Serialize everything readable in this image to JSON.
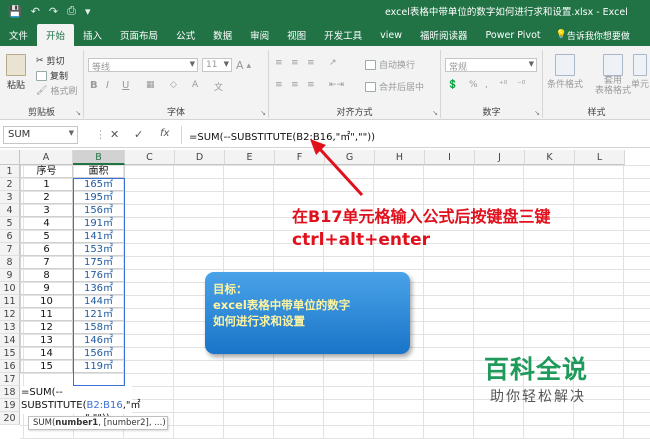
{
  "window": {
    "title": "excel表格中带单位的数字如何进行求和设置.xlsx - Excel"
  },
  "tabs": [
    "文件",
    "开始",
    "插入",
    "页面布局",
    "公式",
    "数据",
    "审阅",
    "视图",
    "开发工具",
    "view",
    "福昕阅读器",
    "Power Pivot"
  ],
  "active_tab": "开始",
  "tell_me": "告诉我你想要做",
  "ribbon": {
    "paste": "粘贴",
    "cut": "剪切",
    "copy": "复制",
    "format_painter": "格式刷",
    "clipboard": "剪贴板",
    "font_name": "等线",
    "font_size": "11",
    "bold": "B",
    "italic": "I",
    "underline": "U",
    "font_group": "字体",
    "wrap_text": "自动换行",
    "merge_center": "合并后居中",
    "alignment_group": "对齐方式",
    "number_format": "常规",
    "percent": "%",
    "comma": ",",
    "number_group": "数字",
    "cond_format": "条件格式",
    "table_format_1": "套用",
    "table_format_2": "表格格式",
    "cell_styles": "单元",
    "styles_group": "样式"
  },
  "formula_bar": {
    "name_box": "SUM",
    "cancel": "✕",
    "enter": "✓",
    "fx": "fx",
    "formula": "=SUM(--SUBSTITUTE(B2:B16,\"㎡\",\"\"))"
  },
  "columns": [
    "A",
    "B",
    "C",
    "D",
    "E",
    "F",
    "G",
    "H",
    "I",
    "J",
    "K",
    "L"
  ],
  "rows": [
    "1",
    "2",
    "3",
    "4",
    "5",
    "6",
    "7",
    "8",
    "9",
    "10",
    "11",
    "12",
    "13",
    "14",
    "15",
    "16",
    "17",
    "18",
    "19",
    "20"
  ],
  "table": {
    "header": [
      "序号",
      "面积"
    ],
    "data": [
      [
        "1",
        "165㎡"
      ],
      [
        "2",
        "195㎡"
      ],
      [
        "3",
        "156㎡"
      ],
      [
        "4",
        "191㎡"
      ],
      [
        "5",
        "141㎡"
      ],
      [
        "6",
        "153㎡"
      ],
      [
        "7",
        "175㎡"
      ],
      [
        "8",
        "176㎡"
      ],
      [
        "9",
        "136㎡"
      ],
      [
        "10",
        "144㎡"
      ],
      [
        "11",
        "121㎡"
      ],
      [
        "12",
        "158㎡"
      ],
      [
        "13",
        "146㎡"
      ],
      [
        "14",
        "156㎡"
      ],
      [
        "15",
        "119㎡"
      ]
    ]
  },
  "editor": {
    "line1_prefix": "=SUM(--SUBSTITUTE(",
    "line1_ref": "B2:B16",
    "line1_suffix": ",\"㎡",
    "line2": "\",\"\"))"
  },
  "tooltip": {
    "fn": "SUM(",
    "arg1": "number1",
    "rest": ", [number2], ...)"
  },
  "annotation": {
    "line1": "在B17单元格输入公式后按键盘三键",
    "line2": "ctrl+alt+enter"
  },
  "callout": {
    "line1": "目标：",
    "line2": "excel表格中带单位的数字",
    "line3": "如何进行求和设置"
  },
  "watermark": {
    "title": "百科全说",
    "subtitle": "助你轻松解决"
  },
  "colors": {
    "excel_green": "#217346",
    "annotation_red": "#e0111d",
    "callout_blue": "#1a74c8",
    "watermark_green": "#1f9a5a"
  }
}
